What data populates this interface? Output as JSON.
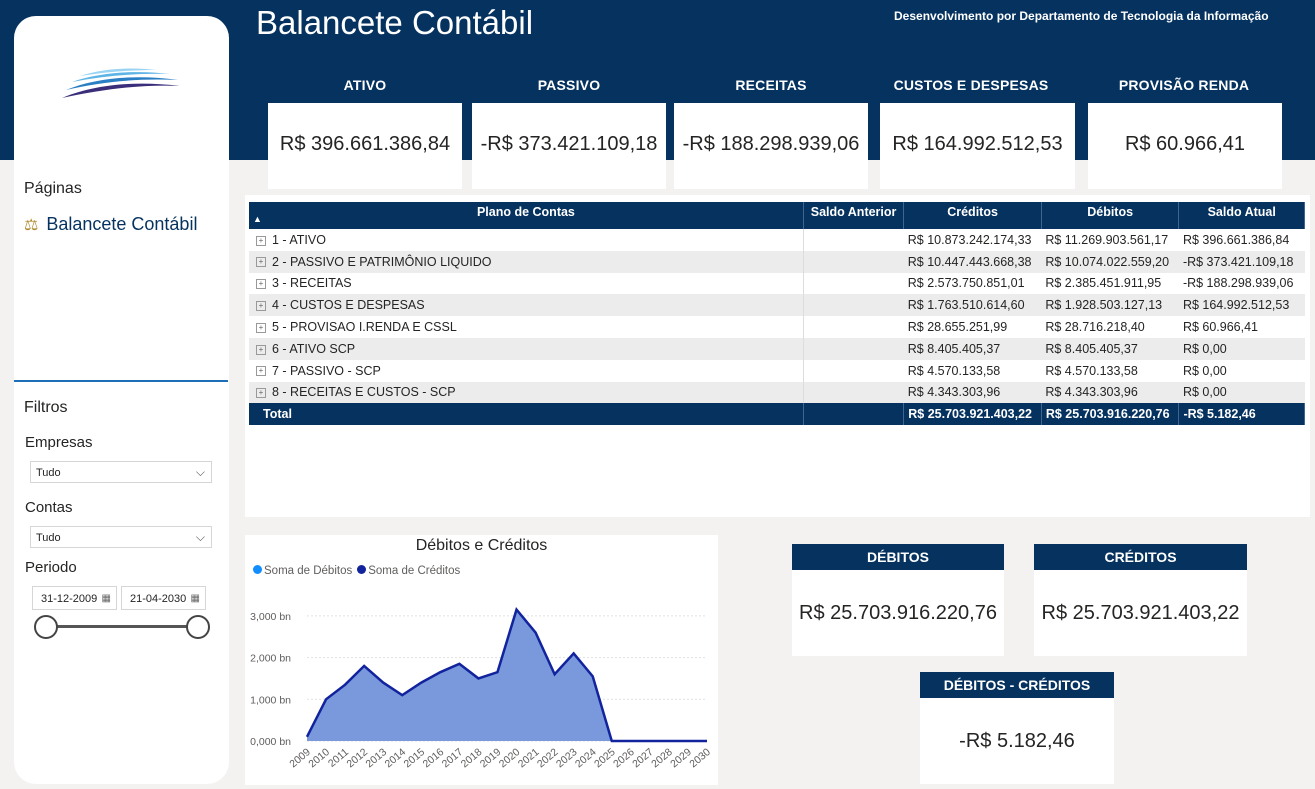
{
  "header": {
    "title": "Balancete Contábil",
    "credit": "Desenvolvimento por Departamento de Tecnologia da Informação"
  },
  "sidebar": {
    "pages_heading": "Páginas",
    "page_link": "Balancete Contábil",
    "filters_heading": "Filtros",
    "empresas_label": "Empresas",
    "empresas_value": "Tudo",
    "contas_label": "Contas",
    "contas_value": "Tudo",
    "periodo_label": "Periodo",
    "date_start": "31-12-2009",
    "date_end": "21-04-2030"
  },
  "kpis": [
    {
      "label": "ATIVO",
      "value": "R$ 396.661.386,84"
    },
    {
      "label": "PASSIVO",
      "value": "-R$ 373.421.109,18"
    },
    {
      "label": "RECEITAS",
      "value": "-R$ 188.298.939,06"
    },
    {
      "label": "CUSTOS E DESPESAS",
      "value": "R$ 164.992.512,53"
    },
    {
      "label": "PROVISÃO RENDA",
      "value": "R$ 60.966,41"
    }
  ],
  "table": {
    "headers": [
      "Plano de Contas",
      "Saldo Anterior",
      "Créditos",
      "Débitos",
      "Saldo Atual"
    ],
    "rows": [
      {
        "conta": "1 - ATIVO",
        "saldo_anterior": "",
        "creditos": "R$ 10.873.242.174,33",
        "debitos": "R$ 11.269.903.561,17",
        "saldo_atual": "R$ 396.661.386,84"
      },
      {
        "conta": "2 - PASSIVO E PATRIMÔNIO LIQUIDO",
        "saldo_anterior": "",
        "creditos": "R$ 10.447.443.668,38",
        "debitos": "R$ 10.074.022.559,20",
        "saldo_atual": "-R$ 373.421.109,18"
      },
      {
        "conta": "3 - RECEITAS",
        "saldo_anterior": "",
        "creditos": "R$ 2.573.750.851,01",
        "debitos": "R$ 2.385.451.911,95",
        "saldo_atual": "-R$ 188.298.939,06"
      },
      {
        "conta": "4 - CUSTOS E DESPESAS",
        "saldo_anterior": "",
        "creditos": "R$ 1.763.510.614,60",
        "debitos": "R$ 1.928.503.127,13",
        "saldo_atual": "R$ 164.992.512,53"
      },
      {
        "conta": "5 - PROVISAO I.RENDA E CSSL",
        "saldo_anterior": "",
        "creditos": "R$ 28.655.251,99",
        "debitos": "R$ 28.716.218,40",
        "saldo_atual": "R$ 60.966,41"
      },
      {
        "conta": "6 - ATIVO SCP",
        "saldo_anterior": "",
        "creditos": "R$ 8.405.405,37",
        "debitos": "R$ 8.405.405,37",
        "saldo_atual": "R$ 0,00"
      },
      {
        "conta": "7 - PASSIVO - SCP",
        "saldo_anterior": "",
        "creditos": "R$ 4.570.133,58",
        "debitos": "R$ 4.570.133,58",
        "saldo_atual": "R$ 0,00"
      },
      {
        "conta": "8 - RECEITAS E CUSTOS - SCP",
        "saldo_anterior": "",
        "creditos": "R$ 4.343.303,96",
        "debitos": "R$ 4.343.303,96",
        "saldo_atual": "R$ 0,00"
      }
    ],
    "total": {
      "label": "Total",
      "saldo_anterior": "",
      "creditos": "R$ 25.703.921.403,22",
      "debitos": "R$ 25.703.916.220,76",
      "saldo_atual": "-R$ 5.182,46"
    }
  },
  "summary": {
    "debitos_label": "DÉBITOS",
    "debitos_value": "R$ 25.703.916.220,76",
    "creditos_label": "CRÉDITOS",
    "creditos_value": "R$ 25.703.921.403,22",
    "diff_label": "DÉBITOS - CRÉDITOS",
    "diff_value": "-R$ 5.182,46"
  },
  "colors": {
    "navy": "#05325f",
    "debitos_series": "#118dff",
    "creditos_series": "#12239e",
    "area_fill": "#6b8ed8"
  },
  "chart_data": {
    "type": "area",
    "title": "Débitos e Créditos",
    "legend_position": "top-left",
    "grid": true,
    "x": [
      "2009",
      "2010",
      "2011",
      "2012",
      "2013",
      "2014",
      "2015",
      "2016",
      "2017",
      "2018",
      "2019",
      "2020",
      "2021",
      "2022",
      "2023",
      "2024",
      "2025",
      "2026",
      "2027",
      "2028",
      "2029",
      "2030"
    ],
    "y_ticks": [
      "0,000 bn",
      "1,000 bn",
      "2,000 bn",
      "3,000 bn"
    ],
    "ylim": [
      0,
      3500
    ],
    "series": [
      {
        "name": "Soma de Débitos",
        "values": [
          100,
          1000,
          1350,
          1800,
          1400,
          1100,
          1400,
          1650,
          1850,
          1500,
          1650,
          3150,
          2600,
          1600,
          2100,
          1550,
          0,
          0,
          0,
          0,
          0,
          0
        ]
      },
      {
        "name": "Soma de Créditos",
        "values": [
          100,
          1000,
          1350,
          1800,
          1400,
          1100,
          1400,
          1650,
          1850,
          1500,
          1650,
          3150,
          2600,
          1600,
          2100,
          1550,
          0,
          0,
          0,
          0,
          0,
          0
        ]
      }
    ]
  }
}
